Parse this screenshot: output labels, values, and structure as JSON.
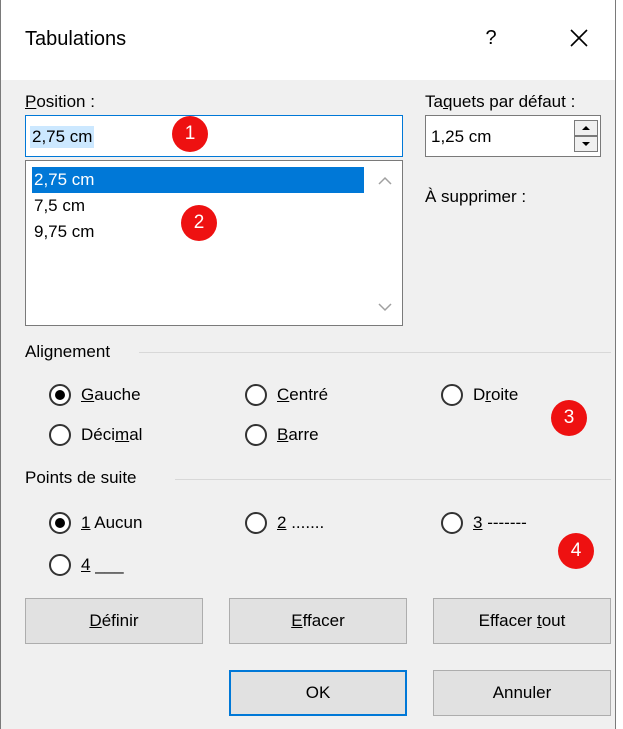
{
  "dialog": {
    "title": "Tabulations",
    "help_label": "?"
  },
  "position": {
    "label_pre": "",
    "label_u": "P",
    "label_post": "osition :",
    "value": "2,75 cm",
    "list": [
      "2,75 cm",
      "7,5 cm",
      "9,75 cm"
    ]
  },
  "default_tabs": {
    "label_pre": "Ta",
    "label_u": "q",
    "label_post": "uets par défaut :",
    "value": "1,25 cm"
  },
  "to_delete": {
    "label": "À supprimer :"
  },
  "alignment": {
    "label": "Alignement",
    "options": [
      {
        "pre": "",
        "u": "G",
        "post": "auche",
        "checked": true
      },
      {
        "pre": "",
        "u": "C",
        "post": "entré",
        "checked": false
      },
      {
        "pre": "D",
        "u": "r",
        "post": "oite",
        "checked": false
      },
      {
        "pre": "Déci",
        "u": "m",
        "post": "al",
        "checked": false
      },
      {
        "pre": "",
        "u": "B",
        "post": "arre",
        "checked": false
      }
    ]
  },
  "leader": {
    "label": "Points de suite",
    "options": [
      {
        "u": "1",
        "post": " Aucun",
        "checked": true
      },
      {
        "u": "2",
        "post": " .......",
        "checked": false
      },
      {
        "u": "3",
        "post": " -------",
        "checked": false
      },
      {
        "u": "4",
        "post": " ___",
        "checked": false
      }
    ]
  },
  "buttons": {
    "set": {
      "pre": "",
      "u": "D",
      "post": "éfinir"
    },
    "clear": {
      "pre": "",
      "u": "E",
      "post": "ffacer"
    },
    "clear_all": {
      "pre": "Effacer ",
      "u": "t",
      "post": "out"
    },
    "ok": "OK",
    "cancel": "Annuler"
  },
  "badges": [
    "1",
    "2",
    "3",
    "4"
  ],
  "colors": {
    "accent": "#0078d7",
    "badge": "#ee1111",
    "selection": "#cce8ff"
  }
}
